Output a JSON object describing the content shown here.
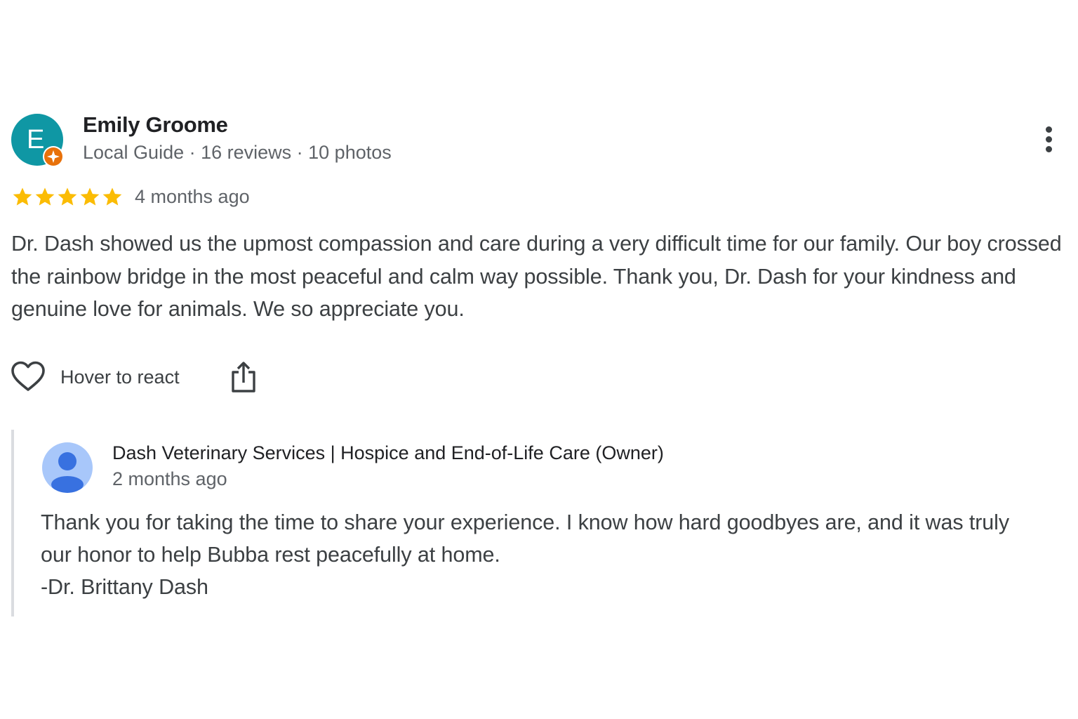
{
  "review": {
    "reviewer": {
      "initial": "E",
      "name": "Emily Groome",
      "meta": "Local Guide · 16 reviews · 10 photos",
      "avatar_color": "#0f97a4",
      "badge_color": "#e8710a"
    },
    "rating": 5,
    "max_rating": 5,
    "star_color": "#fbbc04",
    "date": "4 months ago",
    "text": "Dr. Dash showed us the upmost compassion and care during a very difficult time for our family. Our boy crossed the rainbow bridge in the most peaceful and calm way possible. Thank you, Dr. Dash for your kindness and genuine love for animals. We so appreciate you.",
    "actions": {
      "react_label": "Hover to react",
      "react_icon": "heart-icon",
      "share_icon": "share-icon",
      "more_icon": "more-vert-icon"
    }
  },
  "owner_response": {
    "name": "Dash Veterinary Services | Hospice and End-of-Life Care (Owner)",
    "date": "2 months ago",
    "avatar_icon": "person-icon",
    "text_lines": [
      "Thank you for taking the time to share your experience. I know how hard goodbyes are, and it was truly",
      "our honor to help Bubba rest peacefully at home.",
      "-Dr. Brittany Dash"
    ]
  }
}
